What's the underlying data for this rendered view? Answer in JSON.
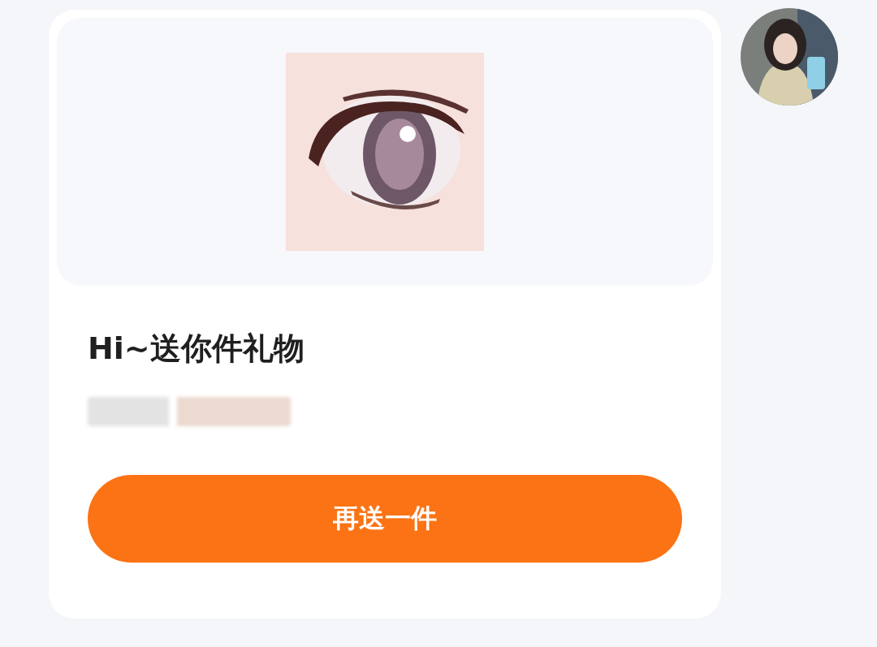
{
  "gift_card": {
    "title": "Hi~送你件礼物",
    "subtitle": {
      "redacted": true
    },
    "button": "再送一件"
  }
}
